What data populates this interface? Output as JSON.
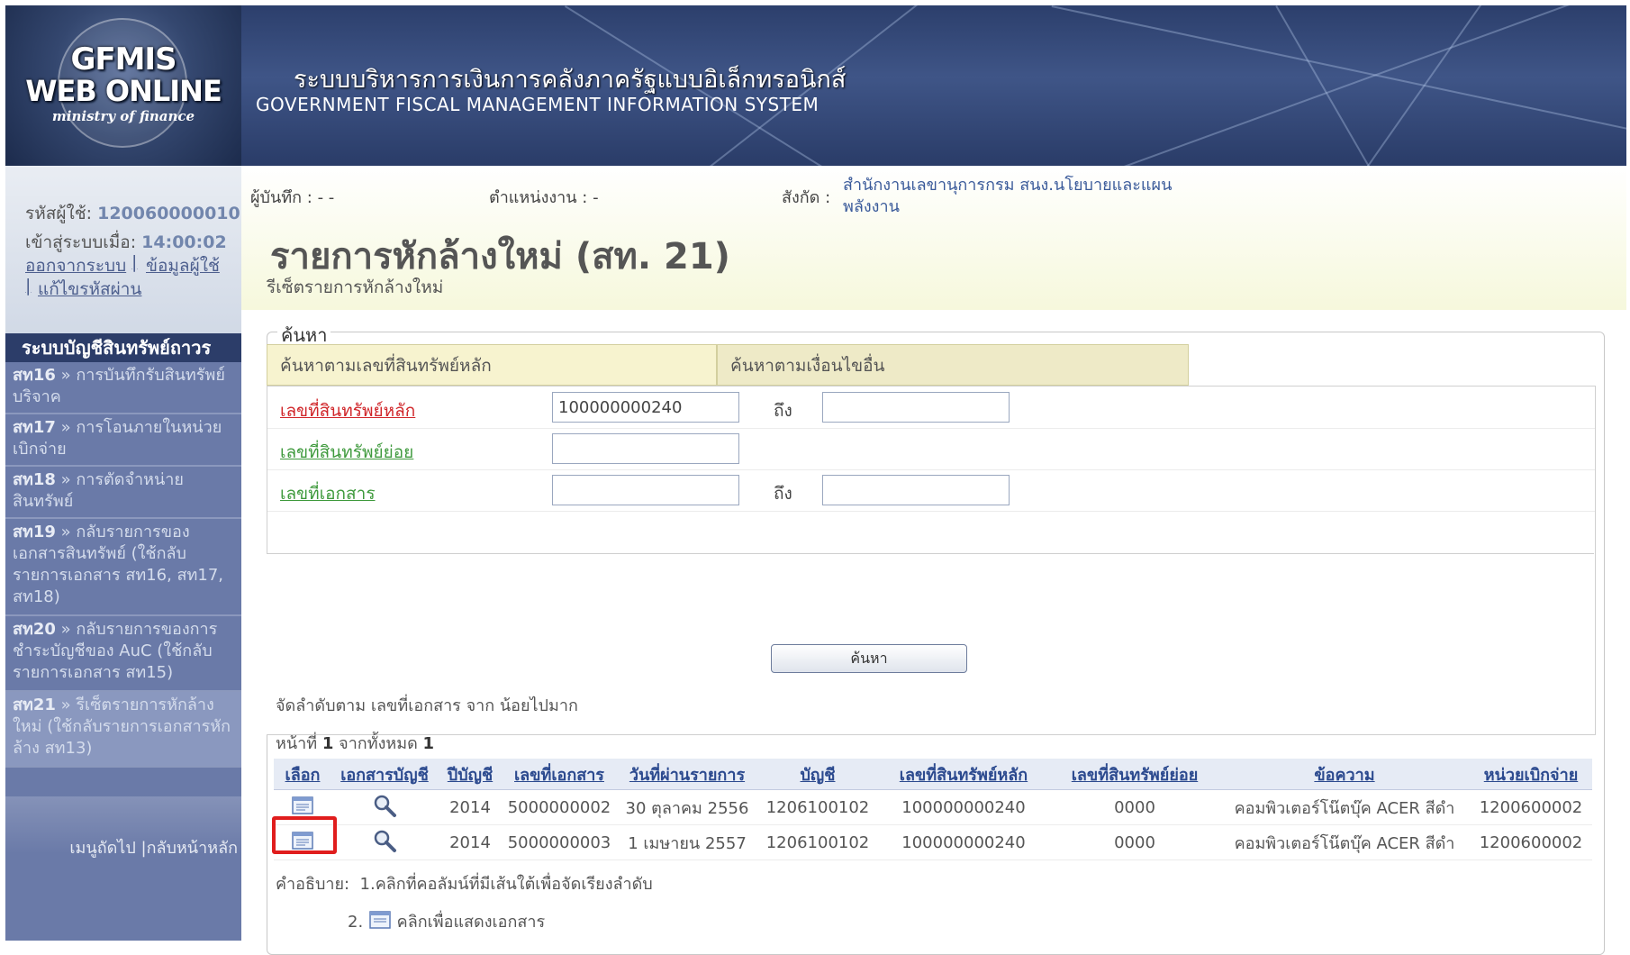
{
  "logo": {
    "line1": "GFMIS",
    "line2": "WEB ONLINE",
    "line3": "ministry of finance"
  },
  "banner": {
    "title_th": "ระบบบริหารการเงินการคลังภาครัฐแบบอิเล็กทรอนิกส์",
    "title_en": "GOVERNMENT FISCAL MANAGEMENT INFORMATION SYSTEM"
  },
  "user": {
    "id_label": "รหัสผู้ใช้:",
    "id_value": "120060000010",
    "login_label": "เข้าสู่ระบบเมื่อ:",
    "login_value": "14:00:02",
    "logout": "ออกจากระบบ",
    "user_info": "ข้อมูลผู้ใช้",
    "change_password": "แก้ไขรหัสผ่าน"
  },
  "menu": {
    "header": "ระบบบัญชีสินทรัพย์ถาวร",
    "items": [
      {
        "code": "สท16",
        "label": "การบันทึกรับสินทรัพย์บริจาค"
      },
      {
        "code": "สท17",
        "label": "การโอนภายในหน่วยเบิกจ่าย"
      },
      {
        "code": "สท18",
        "label": "การตัดจำหน่ายสินทรัพย์"
      },
      {
        "code": "สท19",
        "label": "กลับรายการของเอกสารสินทรัพย์ (ใช้กลับรายการเอกสาร สท16, สท17, สท18)"
      },
      {
        "code": "สท20",
        "label": "กลับรายการของการชำระบัญชีของ AuC (ใช้กลับรายการเอกสาร สท15)"
      },
      {
        "code": "สท21",
        "label": "รีเซ็ตรายการหักล้างใหม่ (ใช้กลับรายการเอกสารหักล้าง สท13)"
      }
    ],
    "footer": "เมนูถัดไป |กลับหน้าหลัก"
  },
  "info": {
    "recorder_label": "ผู้บันทึก :",
    "recorder_value": "- -",
    "position_label": "ตำแหน่งงาน :",
    "position_value": "-",
    "org_label": "สังกัด :",
    "org_line1": "สำนักงานเลขานุการกรม สนง.นโยบายและแผน",
    "org_line2": "พลังงาน"
  },
  "page": {
    "title": "รายการหักล้างใหม่ (สท. 21)",
    "subtitle": "รีเซ็ตรายการหักล้างใหม่"
  },
  "search": {
    "legend": "ค้นหา",
    "tab_main": "ค้นหาตามเลขที่สินทรัพย์หลัก",
    "tab_other": "ค้นหาตามเงื่อนไขอื่น",
    "asset_main_label": "เลขที่สินทรัพย์หลัก",
    "asset_main_from": "100000000240",
    "asset_main_to": "",
    "asset_sub_label": "เลขที่สินทรัพย์ย่อย",
    "asset_sub_value": "",
    "doc_no_label": "เลขที่เอกสาร",
    "doc_no_from": "",
    "doc_no_to": "",
    "to_label": "ถึง",
    "button": "ค้นหา"
  },
  "results": {
    "sort_text": "จัดลำดับตาม เลขที่เอกสาร จาก น้อยไปมาก",
    "page_prefix": "หน้าที่",
    "page_current": "1",
    "page_mid": "จากทั้งหมด",
    "page_total": "1",
    "columns": [
      "เลือก",
      "เอกสารบัญชี",
      "ปีบัญชี",
      "เลขที่เอกสาร",
      "วันที่ผ่านรายการ",
      "บัญชี",
      "เลขที่สินทรัพย์หลัก",
      "เลขที่สินทรัพย์ย่อย",
      "ข้อความ",
      "หน่วยเบิกจ่าย"
    ],
    "rows": [
      {
        "year": "2014",
        "doc_no": "5000000002",
        "post_date": "30 ตุลาคม 2556",
        "account": "1206100102",
        "asset_main": "100000000240",
        "asset_sub": "0000",
        "text": "คอมพิวเตอร์โน๊ตบุ๊ค ACER สีดำ",
        "unit": "1200600002"
      },
      {
        "year": "2014",
        "doc_no": "5000000003",
        "post_date": "1 เมษายน 2557",
        "account": "1206100102",
        "asset_main": "100000000240",
        "asset_sub": "0000",
        "text": "คอมพิวเตอร์โน๊ตบุ๊ค ACER สีดำ",
        "unit": "1200600002"
      }
    ],
    "legend_label": "คำอธิบาย:",
    "legend_1": "1.คลิกที่คอลัมน์ที่มีเส้นใต้เพื่อจัดเรียงลำดับ",
    "legend_2_prefix": "2.",
    "legend_2": "คลิกเพื่อแสดงเอกสาร"
  }
}
